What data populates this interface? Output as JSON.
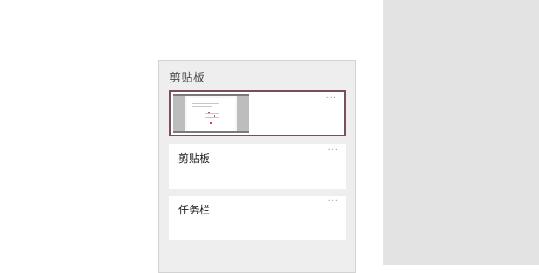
{
  "clipboard": {
    "title": "剪贴板",
    "more_label": "···",
    "items": [
      {
        "type": "image",
        "description": "screenshot thumbnail"
      },
      {
        "type": "text",
        "text": "剪贴板"
      },
      {
        "type": "text",
        "text": "任务栏"
      }
    ]
  },
  "colors": {
    "selection_border": "#7a4d5a",
    "panel_bg": "#eeeeee",
    "right_pane_bg": "#e3e3e3"
  }
}
